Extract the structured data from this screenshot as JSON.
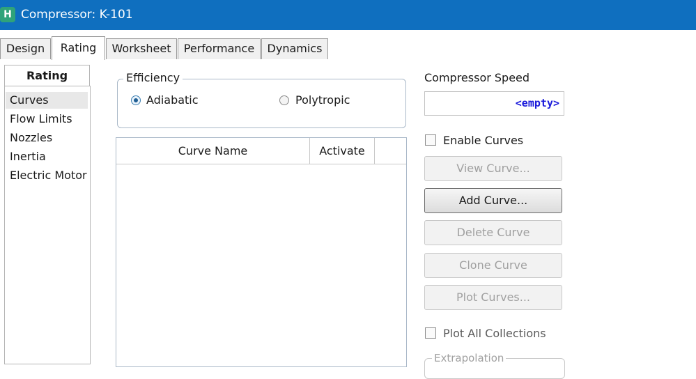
{
  "window": {
    "title": "Compressor: K-101",
    "app_icon_glyph": "H"
  },
  "tabs": [
    {
      "label": "Design"
    },
    {
      "label": "Rating",
      "active": true
    },
    {
      "label": "Worksheet"
    },
    {
      "label": "Performance"
    },
    {
      "label": "Dynamics"
    }
  ],
  "sidebar": {
    "title": "Rating",
    "items": [
      {
        "label": "Curves",
        "selected": true
      },
      {
        "label": "Flow Limits"
      },
      {
        "label": "Nozzles"
      },
      {
        "label": "Inertia"
      },
      {
        "label": "Electric Motor"
      }
    ]
  },
  "efficiency": {
    "legend": "Efficiency",
    "options": [
      {
        "label": "Adiabatic",
        "checked": true
      },
      {
        "label": "Polytropic",
        "checked": false
      }
    ]
  },
  "curve_table": {
    "columns": [
      "Curve Name",
      "Activate"
    ],
    "rows": []
  },
  "compressor_speed": {
    "label": "Compressor Speed",
    "value": "<empty>"
  },
  "enable_curves": {
    "label": "Enable Curves",
    "checked": false
  },
  "buttons": {
    "view_curve": "View Curve...",
    "add_curve": "Add Curve...",
    "delete_curve": "Delete Curve",
    "clone_curve": "Clone Curve",
    "plot_curves": "Plot Curves..."
  },
  "plot_all_collections": {
    "label": "Plot All Collections",
    "checked": false
  },
  "extrapolation": {
    "legend": "Extrapolation"
  },
  "colors": {
    "titlebar": "#0f6fbf",
    "empty_value": "#1a1adb"
  }
}
